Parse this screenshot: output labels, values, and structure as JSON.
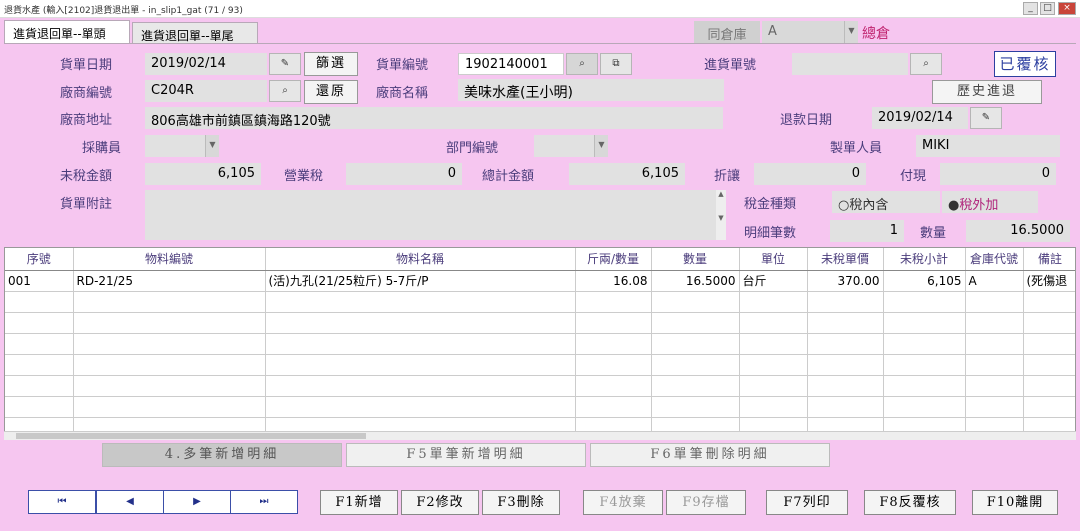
{
  "window": {
    "title": "退貨水產 (輸入[2102]退貨退出單 - in_slip1_gat (71 / 93)"
  },
  "tabs": {
    "header": "進貨退回單--單頭",
    "footer": "進貨退回單--單尾"
  },
  "top": {
    "warehouse_label": "同倉庫",
    "warehouse_value": "A",
    "warehouse_name": "總倉"
  },
  "form": {
    "doc_date_label": "貨單日期",
    "doc_date": "2019/02/14",
    "filter_btn": "篩選",
    "doc_no_label": "貨單編號",
    "doc_no": "1902140001",
    "purchase_no_label": "進貨單號",
    "purchase_no": "",
    "reviewed_btn": "已覆核",
    "vendor_id_label": "廠商編號",
    "vendor_id": "C204R",
    "restore_btn": "還原",
    "vendor_name_label": "廠商名稱",
    "vendor_name": "美味水產(王小明)",
    "history_btn": "歷史進退",
    "vendor_addr_label": "廠商地址",
    "vendor_addr": "806高雄市前鎮區鎮海路120號",
    "refund_date_label": "退款日期",
    "refund_date": "2019/02/14",
    "buyer_label": "採購員",
    "dept_label": "部門編號",
    "maker_label": "製單人員",
    "maker": "MIKI",
    "pretax_label": "未稅金額",
    "pretax": "6,105",
    "tax_label": "營業稅",
    "tax": "0",
    "total_label": "總計金額",
    "total": "6,105",
    "discount_label": "折讓",
    "discount": "0",
    "paid_label": "付現",
    "paid": "0",
    "remark_label": "貨單附註",
    "taxtype_label": "稅金種類",
    "tax_incl": "稅內含",
    "tax_excl": "稅外加",
    "detail_count_label": "明細筆數",
    "detail_count": "1",
    "qty_label": "數量",
    "qty": "16.5000"
  },
  "table": {
    "headers": [
      "序號",
      "物料編號",
      "物料名稱",
      "斤兩/數量",
      "數量",
      "單位",
      "未稅單價",
      "未稅小計",
      "倉庫代號",
      "備註"
    ],
    "rows": [
      [
        "001",
        "RD-21/25",
        "(活)九孔(21/25粒斤) 5-7斤/P",
        "16.08",
        "16.5000",
        "台斤",
        "370.00",
        "6,105",
        "A",
        "(死傷退"
      ]
    ]
  },
  "detail_buttons": {
    "multi_add": "4.多筆新增明細",
    "single_add": "F5單筆新增明細",
    "delete": "F6單筆刪除明細"
  },
  "nav": {
    "first": "⏮",
    "prev": "◀",
    "next": "▶",
    "last": "⏭"
  },
  "fkeys": {
    "f1": "F1新增",
    "f2": "F2修改",
    "f3": "F3刪除",
    "f4": "F4放棄",
    "f9": "F9存檔",
    "f7": "F7列印",
    "f8": "F8反覆核",
    "f10": "F10離開"
  }
}
